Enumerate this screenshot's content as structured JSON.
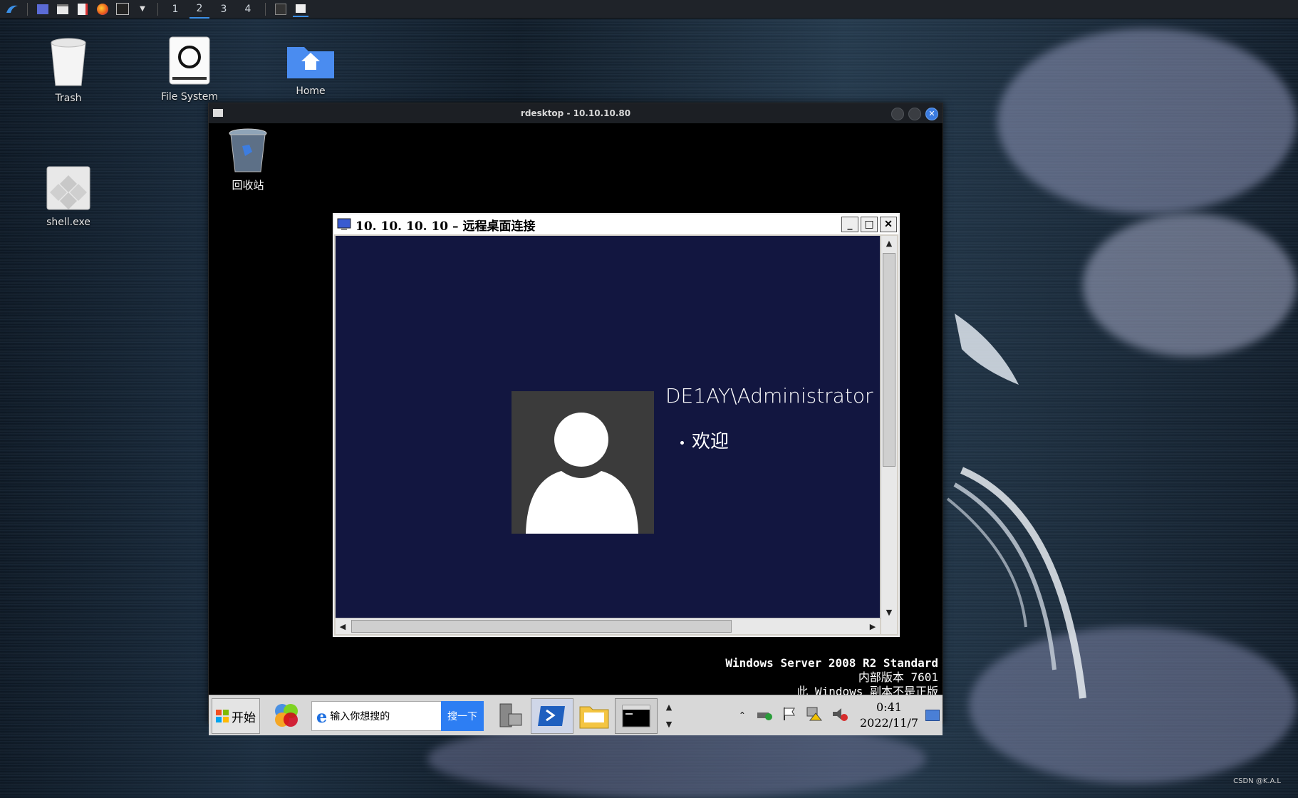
{
  "topbar": {
    "workspaces": [
      "1",
      "2",
      "3",
      "4"
    ],
    "active_workspace": "2"
  },
  "desktop_icons": [
    {
      "label": "Trash"
    },
    {
      "label": "File System"
    },
    {
      "label": "Home"
    },
    {
      "label": "shell.exe"
    }
  ],
  "rdesktop": {
    "title": "rdesktop - 10.10.10.80",
    "remote_desktop_icons": [
      {
        "label": "回收站"
      }
    ],
    "inner_window": {
      "title": "10. 10. 10. 10 – 远程桌面连接",
      "username": "DE1AY\\Administrator",
      "welcome": "欢迎"
    },
    "watermark": {
      "line1": "Windows Server 2008 R2 Standard",
      "line2": "内部版本 7601",
      "line3": "此 Windows 副本不是正版"
    },
    "taskbar": {
      "start_label": "开始",
      "search_placeholder": "输入你想搜的",
      "search_button": "搜一下",
      "time": "0:41",
      "date": "2022/11/7"
    }
  },
  "credit": "CSDN @K.A.L"
}
